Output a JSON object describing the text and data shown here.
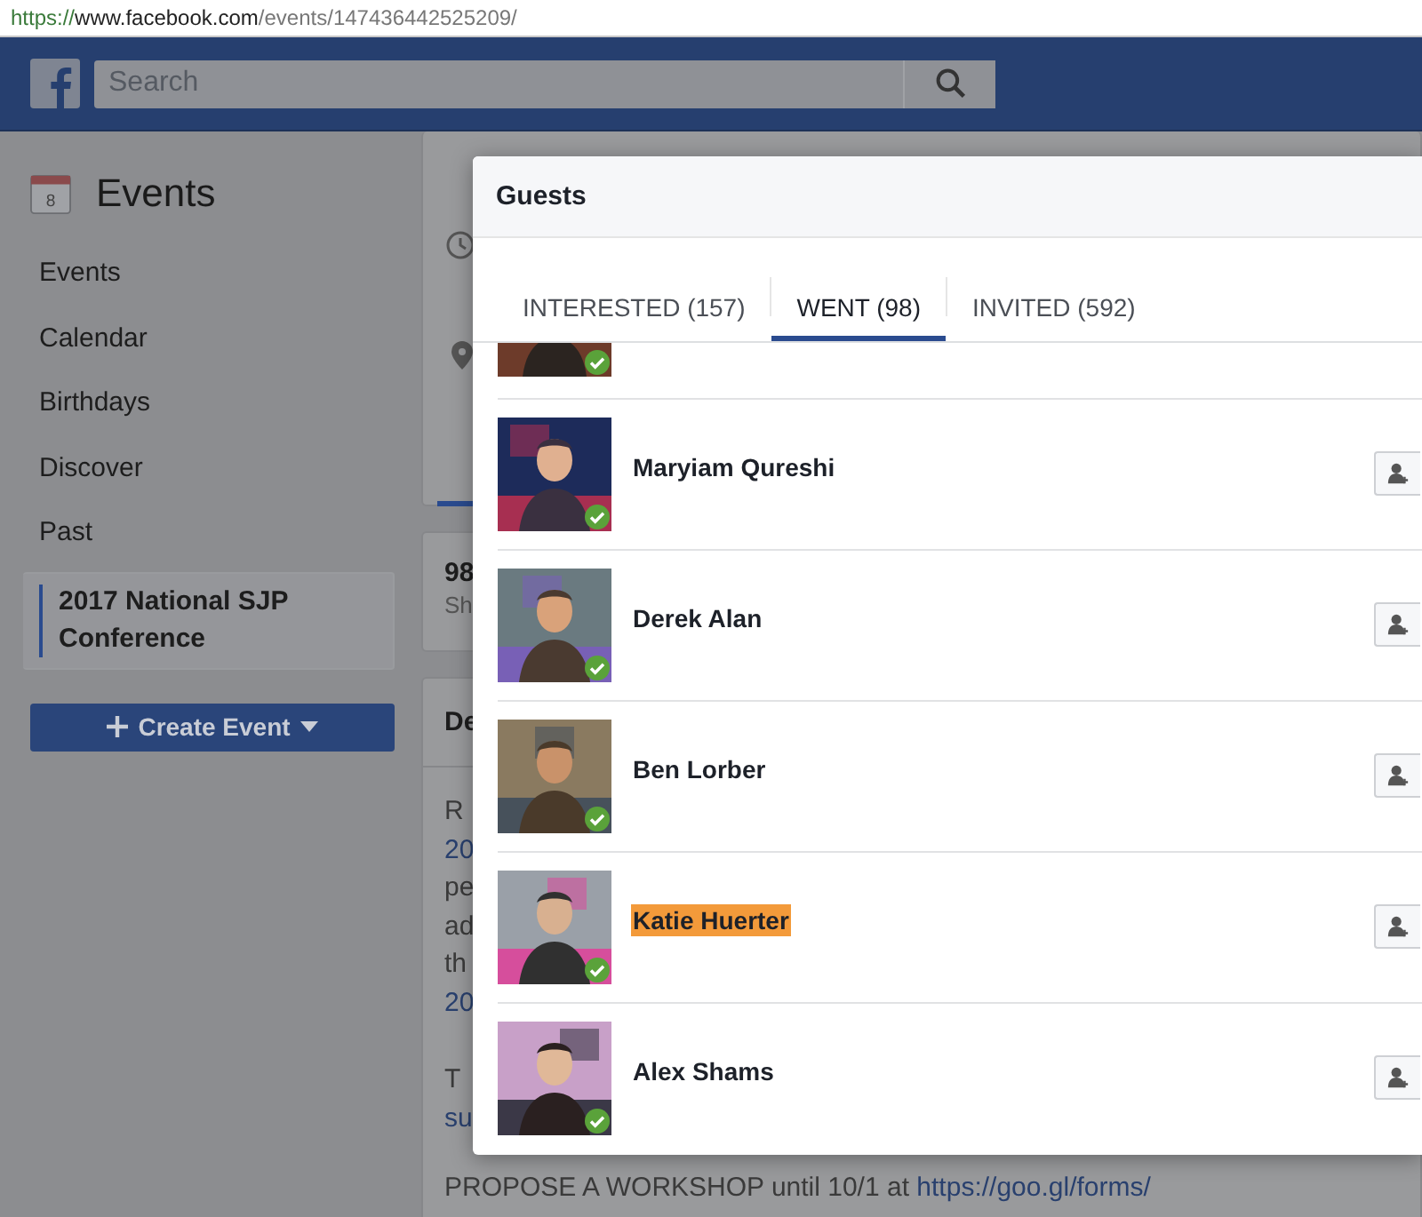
{
  "browser": {
    "url": {
      "scheme": "https://",
      "host": "www.facebook.com",
      "path": "/events/147436442525209/"
    }
  },
  "header": {
    "search": {
      "placeholder": "Search"
    }
  },
  "sidebar": {
    "title": "Events",
    "calendar_day": "8",
    "items": [
      {
        "label": "Events",
        "selected": false
      },
      {
        "label": "Calendar",
        "selected": false
      },
      {
        "label": "Birthdays",
        "selected": false
      },
      {
        "label": "Discover",
        "selected": false
      },
      {
        "label": "Past",
        "selected": false
      },
      {
        "label": "2017 National SJP Conference",
        "selected": true
      }
    ],
    "create_button": {
      "label": "Create Event"
    }
  },
  "background": {
    "stats": {
      "count": "98",
      "sub": "Sh"
    },
    "details": {
      "heading": "De",
      "paragraphs": [
        [
          {
            "text": "R",
            "link": false
          },
          {
            "text": "20",
            "link": true
          },
          {
            "text": "pe",
            "link": false
          },
          {
            "text": "ad",
            "link": false
          },
          {
            "text": "th",
            "link": false
          },
          {
            "text": "20",
            "link": true
          }
        ],
        [
          {
            "text": "T",
            "link": false
          },
          {
            "text": "su",
            "link": true
          }
        ]
      ],
      "footer": {
        "text": "PROPOSE A WORKSHOP until 10/1 at",
        "link": "https://goo.gl/forms/"
      }
    }
  },
  "guests_dialog": {
    "title": "Guests",
    "tabs": [
      {
        "label": "INTERESTED (157)",
        "selected": false
      },
      {
        "label": "WENT (98)",
        "selected": true
      },
      {
        "label": "INVITED (592)",
        "selected": false
      }
    ],
    "guests": [
      {
        "kind": "cut-off",
        "went": true
      },
      {
        "kind": "full",
        "name": "Maryiam Qureshi",
        "highlighted": false,
        "went": true
      },
      {
        "kind": "full",
        "name": "Derek Alan",
        "highlighted": false,
        "went": true
      },
      {
        "kind": "full",
        "name": "Ben Lorber",
        "highlighted": false,
        "went": true
      },
      {
        "kind": "full",
        "name": "Katie Huerter",
        "highlighted": true,
        "went": true
      },
      {
        "kind": "full",
        "name": "Alex Shams",
        "highlighted": false,
        "went": true
      }
    ]
  }
}
